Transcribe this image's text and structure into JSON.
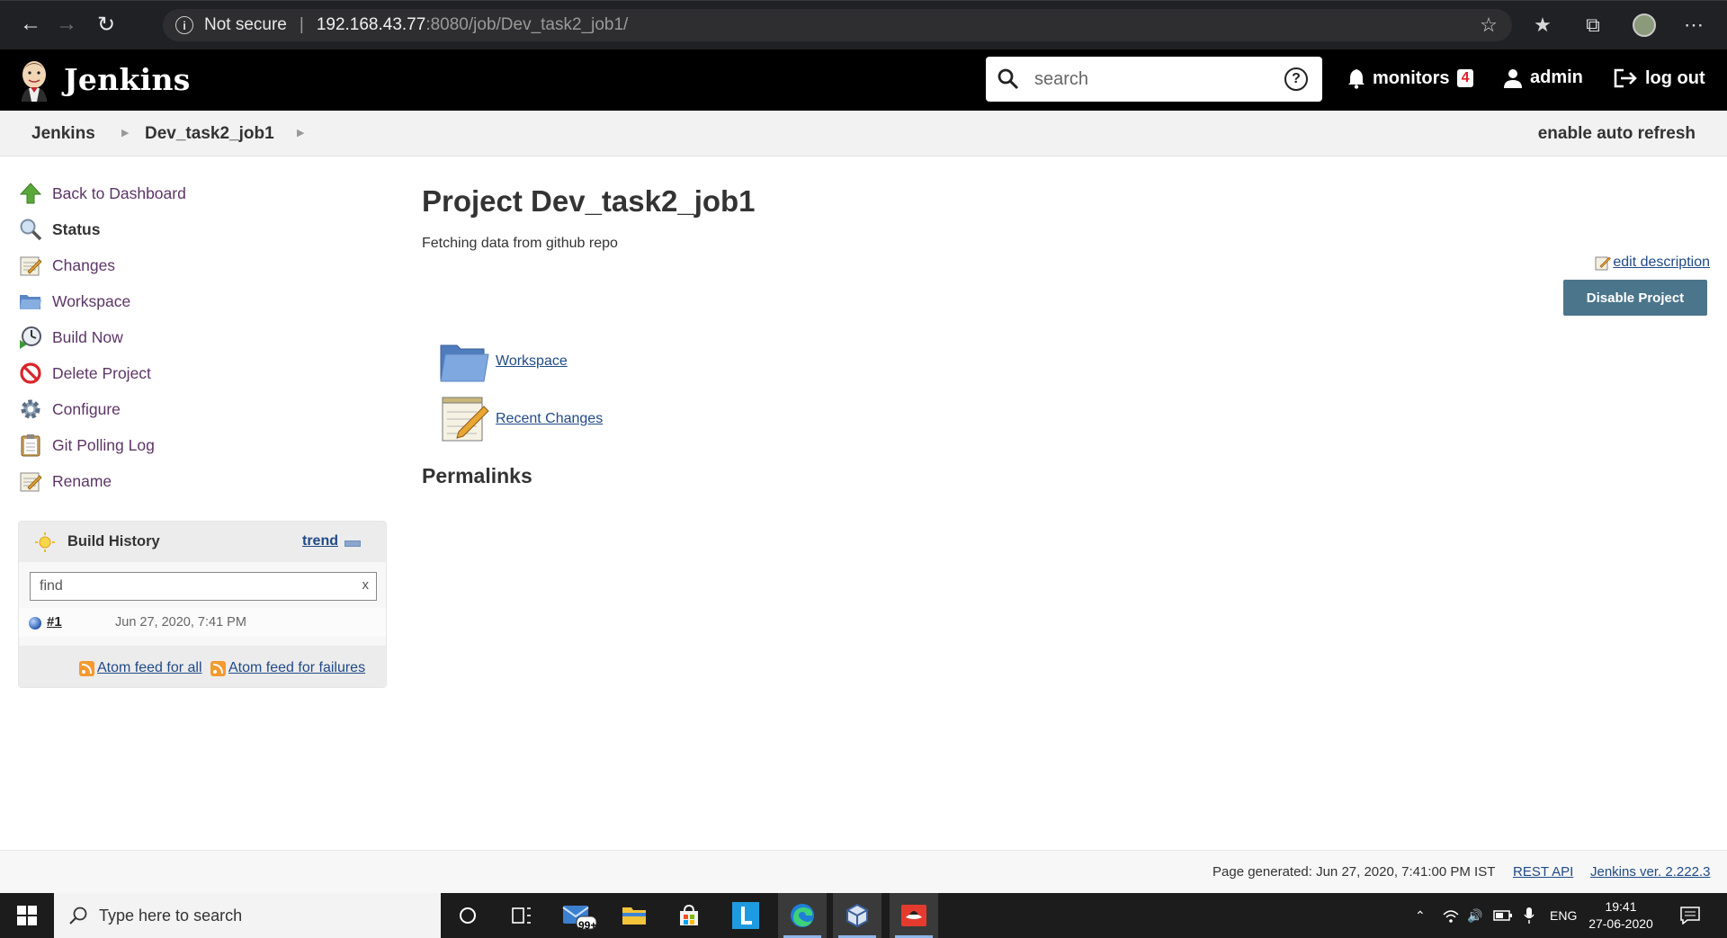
{
  "browser": {
    "security_label": "Not secure",
    "url_host": "192.168.43.77",
    "url_path": ":8080/job/Dev_task2_job1/"
  },
  "header": {
    "brand": "Jenkins",
    "search_placeholder": "search",
    "monitors_label": "monitors",
    "monitors_count": "4",
    "user_label": "admin",
    "logout_label": "log out"
  },
  "breadcrumb": {
    "items": [
      "Jenkins",
      "Dev_task2_job1"
    ],
    "auto_refresh": "enable auto refresh"
  },
  "sidebar": {
    "tasks": [
      {
        "label": "Back to Dashboard",
        "icon": "up-arrow-icon"
      },
      {
        "label": "Status",
        "icon": "magnifier-icon"
      },
      {
        "label": "Changes",
        "icon": "notepad-icon"
      },
      {
        "label": "Workspace",
        "icon": "folder-icon"
      },
      {
        "label": "Build Now",
        "icon": "clock-play-icon"
      },
      {
        "label": "Delete Project",
        "icon": "no-entry-icon"
      },
      {
        "label": "Configure",
        "icon": "gear-icon"
      },
      {
        "label": "Git Polling Log",
        "icon": "clipboard-icon"
      },
      {
        "label": "Rename",
        "icon": "notepad-icon"
      }
    ]
  },
  "build_history": {
    "title": "Build History",
    "trend_label": "trend",
    "find_placeholder": "find",
    "clear_label": "x",
    "builds": [
      {
        "number": "#1",
        "date": "Jun 27, 2020, 7:41 PM",
        "status_color": "#2a5db0"
      }
    ],
    "feed_all": "Atom feed for all",
    "feed_failures": "Atom feed for failures"
  },
  "main": {
    "title": "Project Dev_task2_job1",
    "description": "Fetching data from github repo",
    "edit_description": "edit description",
    "disable_button": "Disable Project",
    "links": [
      {
        "label": "Workspace",
        "icon": "folder-icon"
      },
      {
        "label": "Recent Changes",
        "icon": "notepad-icon"
      }
    ],
    "permalinks_heading": "Permalinks"
  },
  "footer": {
    "generated": "Page generated: Jun 27, 2020, 7:41:00 PM IST",
    "rest_api": "REST API",
    "version": "Jenkins ver. 2.222.3"
  },
  "taskbar": {
    "search_placeholder": "Type here to search",
    "mail_badge": "99+",
    "language": "ENG",
    "time": "19:41",
    "date": "27-06-2020"
  },
  "colors": {
    "link": "#204a87",
    "task_link": "#5c3566",
    "disable_button": "#4b758b",
    "header_bg": "#000000"
  }
}
